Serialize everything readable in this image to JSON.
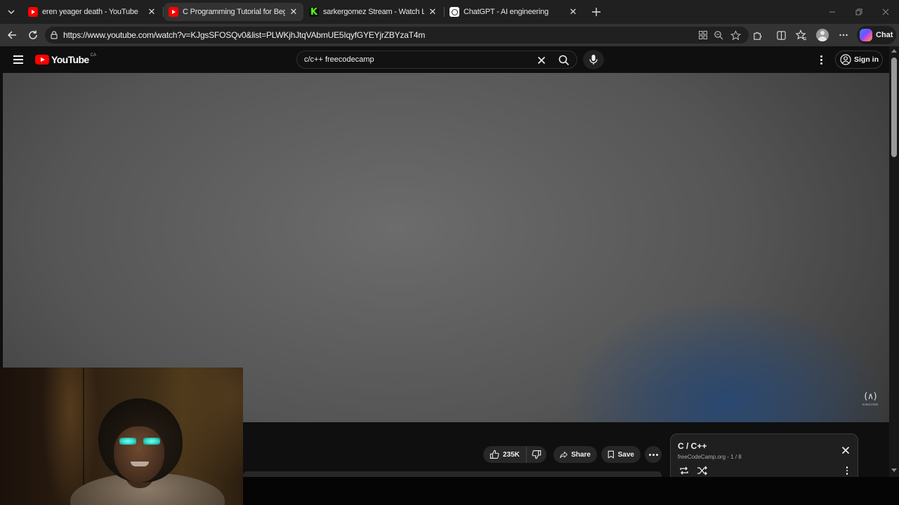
{
  "browser": {
    "tabs": [
      {
        "title": "eren yeager death - YouTube",
        "favicon": "youtube-icon",
        "active": false
      },
      {
        "title": "C Programming Tutorial for Begin",
        "favicon": "youtube-icon",
        "active": true
      },
      {
        "title": "sarkergomez Stream - Watch Live",
        "favicon": "kick-icon",
        "active": false
      },
      {
        "title": "ChatGPT - AI engineering",
        "favicon": "chatgpt-icon",
        "active": false
      }
    ],
    "url": "https://www.youtube.com/watch?v=KJgsSFOSQv0&list=PLWKjhJtqVAbmUE5IqyfGYEYjrZBYzaT4m",
    "chat_label": "Chat"
  },
  "youtube": {
    "logo_text": "YouTube",
    "logo_country": "CA",
    "search_value": "c/c++ freecodecamp",
    "sign_in_label": "Sign in",
    "watermark_glyph": "(∧)",
    "watermark_sub": "SUBSCRIBE"
  },
  "actions": {
    "like_count": "235K",
    "share_label": "Share",
    "save_label": "Save"
  },
  "playlist": {
    "title": "C / C++",
    "channel_position": "freeCodeCamp.org - 1 / 8"
  },
  "colors": {
    "youtube_red": "#ff0000",
    "page_bg": "#0f0f0f",
    "button_bg": "#272727",
    "copilot_gradient": [
      "#2f8cff",
      "#7b4dff",
      "#ff5aa0",
      "#ffb02e"
    ],
    "webcam_glasses": "#2fd8c8"
  }
}
